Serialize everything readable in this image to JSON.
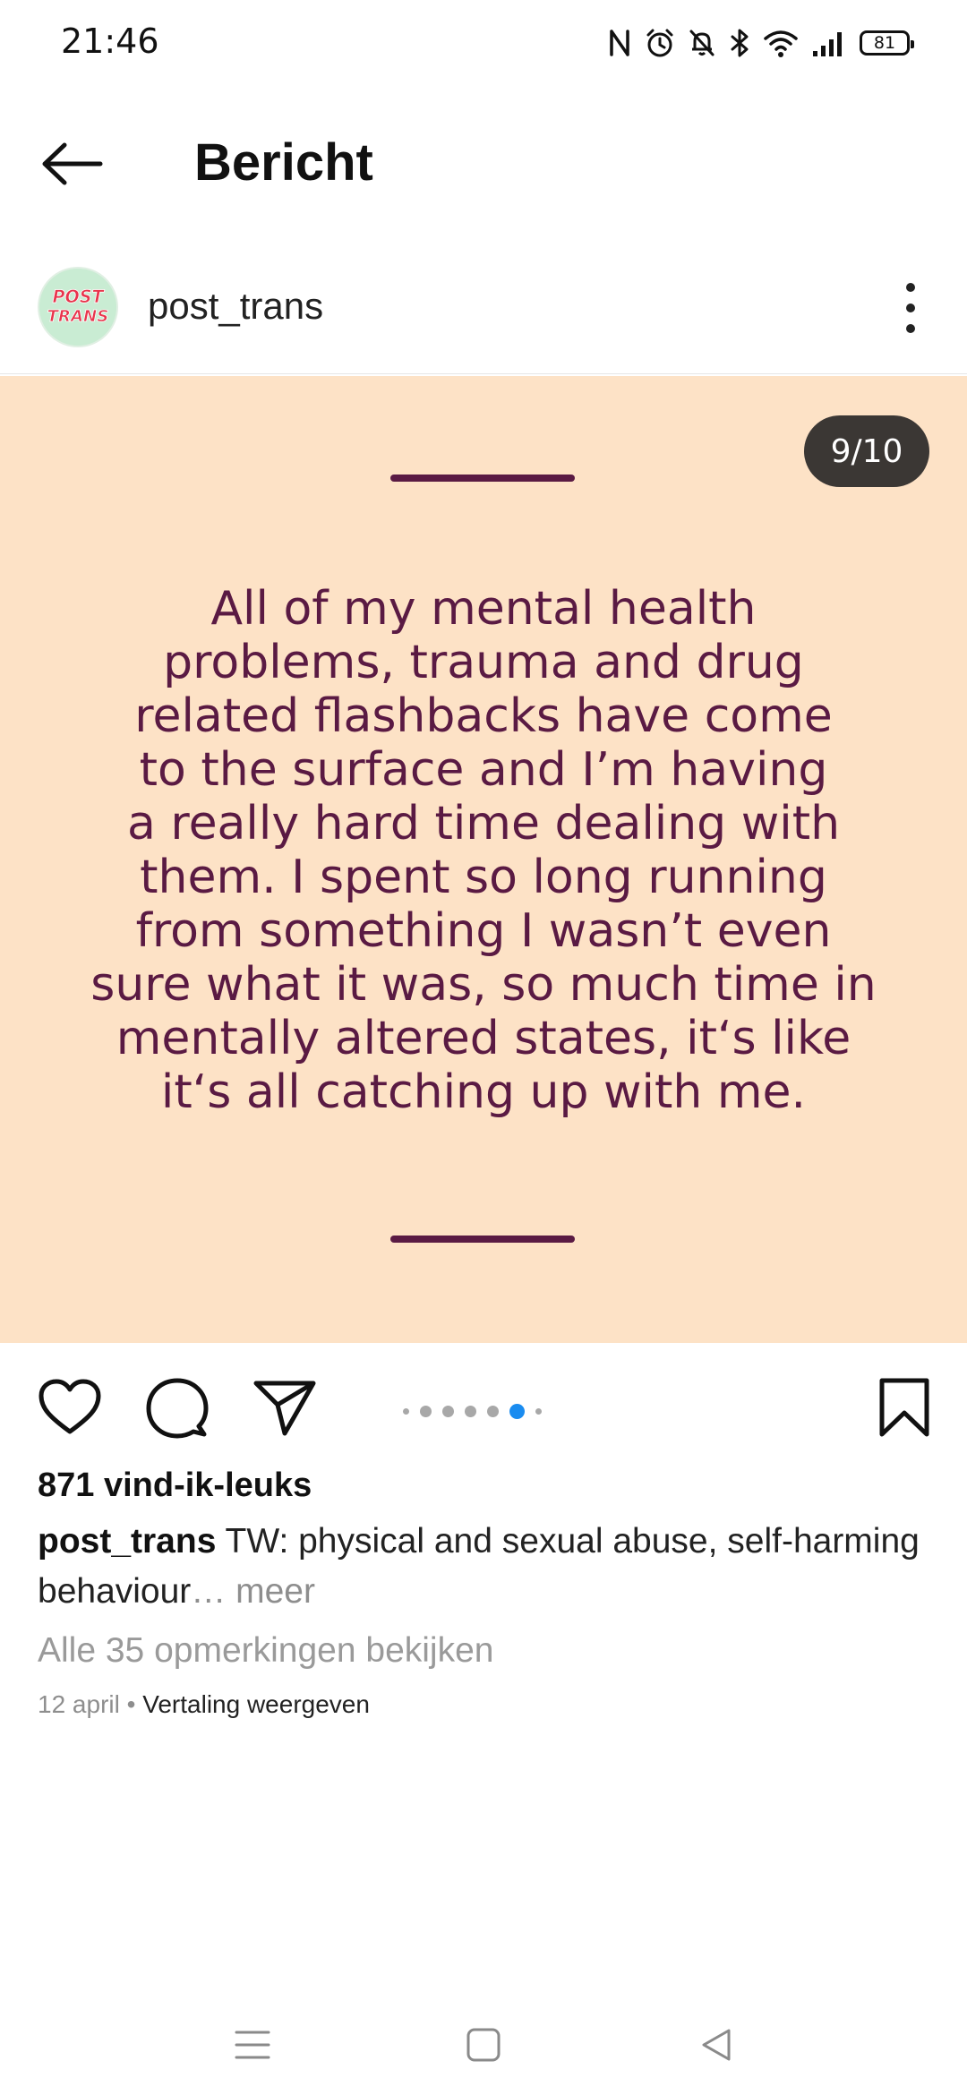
{
  "status_bar": {
    "time": "21:46",
    "battery": "81",
    "icons": [
      "nfc-icon",
      "alarm-icon",
      "bell-off-icon",
      "bluetooth-icon",
      "wifi-icon",
      "signal-icon",
      "battery-icon"
    ]
  },
  "header": {
    "title": "Bericht",
    "back_icon": "arrow-left-icon"
  },
  "author": {
    "username": "post_trans",
    "avatar_text_1": "POST",
    "avatar_text_2": "TRANS",
    "more_icon": "more-vertical-icon"
  },
  "post": {
    "counter": "9/10",
    "background_color": "#fde2c6",
    "text_color": "#5a1a43",
    "quote_lines": [
      "All of my mental health",
      "problems, trauma and drug",
      "related flashbacks have come",
      "to the surface and I’m having",
      "a really hard time dealing with",
      "them. I spent so long running",
      "from something I wasn’t even",
      "sure what it was, so much time in",
      "mentally altered states, it‘s like",
      "it‘s all catching up with me."
    ]
  },
  "carousel": {
    "current": 9,
    "total": 10,
    "accent_color": "#1a8cf0"
  },
  "actions": {
    "like_icon": "heart-icon",
    "comment_icon": "comment-icon",
    "share_icon": "send-icon",
    "save_icon": "bookmark-icon"
  },
  "likes_text": "871 vind-ik-leuks",
  "caption": {
    "username": "post_trans",
    "text": " TW: physical and sexual abuse, self-harming behaviour",
    "more": "… meer"
  },
  "view_comments": "Alle 35 opmerkingen bekijken",
  "meta": {
    "date": "12 april",
    "separator": " • ",
    "translate": "Vertaling weergeven"
  },
  "nav_bar": {
    "icons": [
      "menu-icon",
      "home-square-icon",
      "back-triangle-icon"
    ]
  }
}
